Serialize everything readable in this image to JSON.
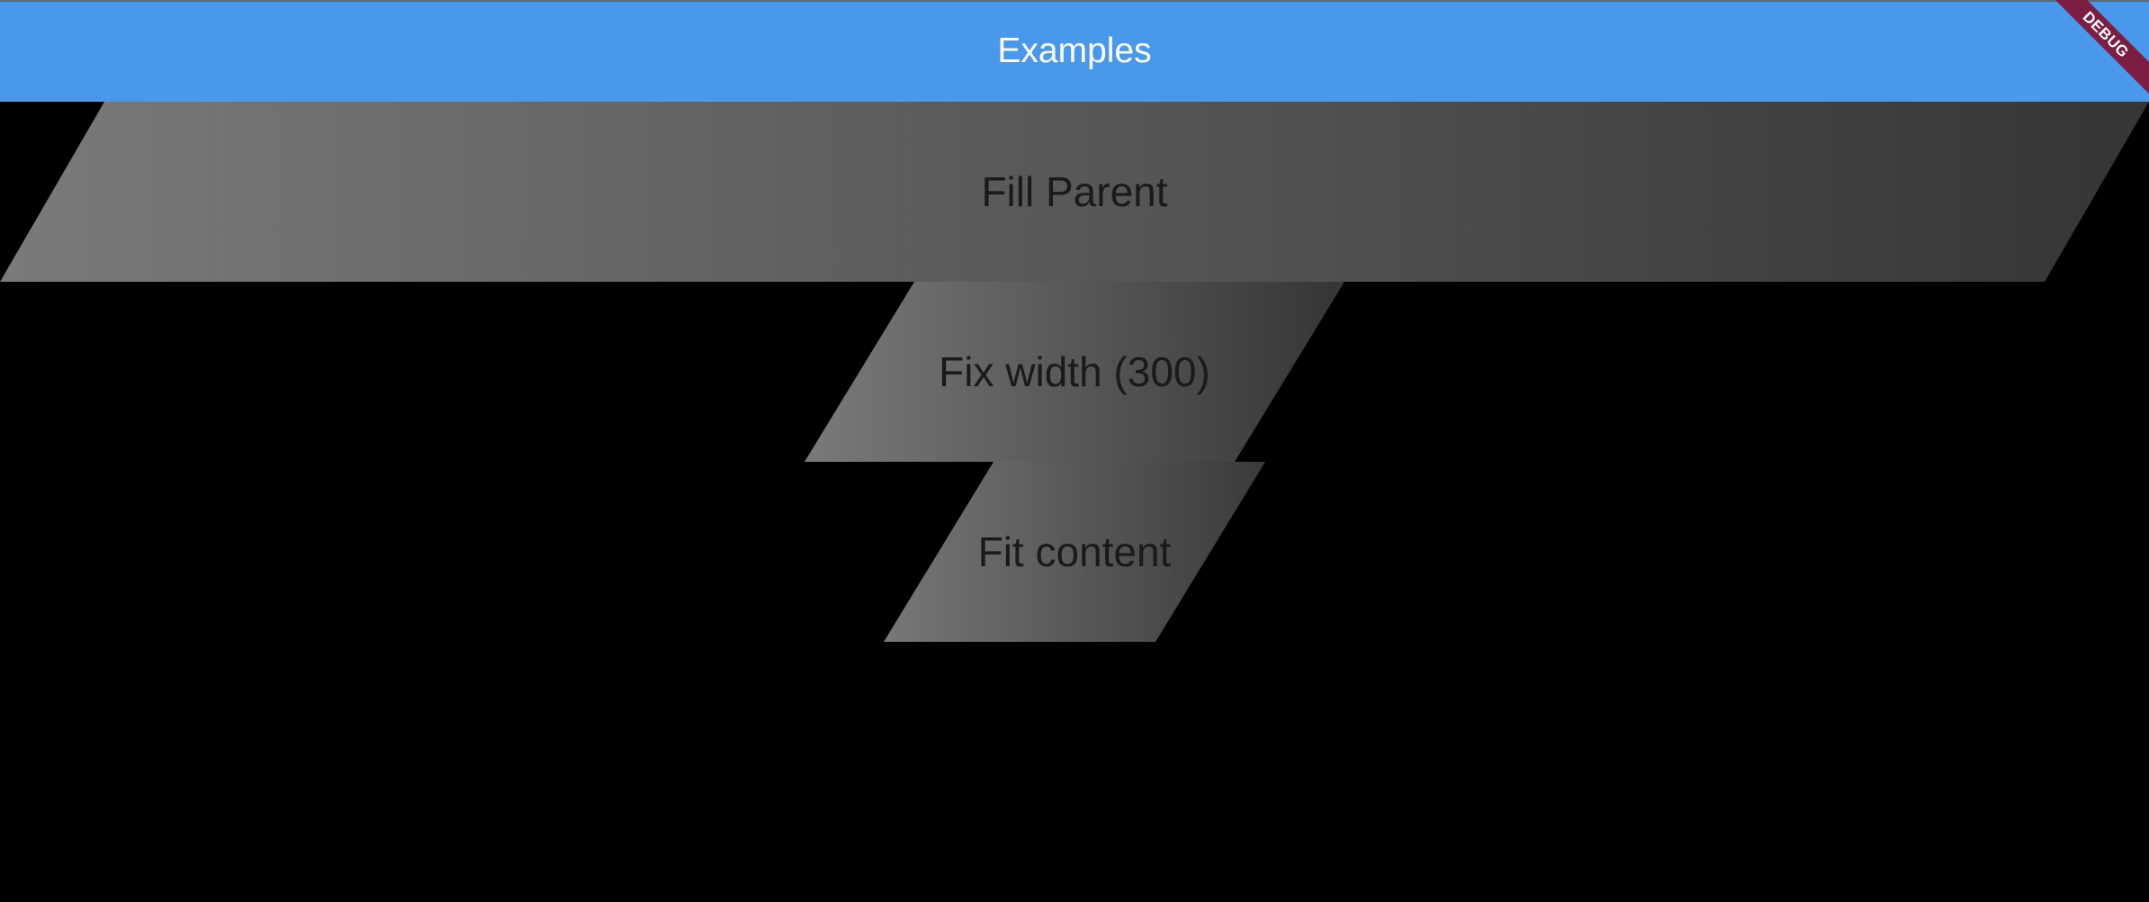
{
  "appbar": {
    "title": "Examples"
  },
  "debug_banner": {
    "label": "DEBUG",
    "color": "#7b1e3f"
  },
  "colors": {
    "appbar_background": "#4a98eb",
    "page_background": "#000000",
    "gradient_start": "#7a7a7a",
    "gradient_end": "#353535",
    "label_text": "#1a1a1a"
  },
  "examples": [
    {
      "label": "Fill Parent"
    },
    {
      "label": "Fix width (300)"
    },
    {
      "label": "Fit content"
    }
  ]
}
